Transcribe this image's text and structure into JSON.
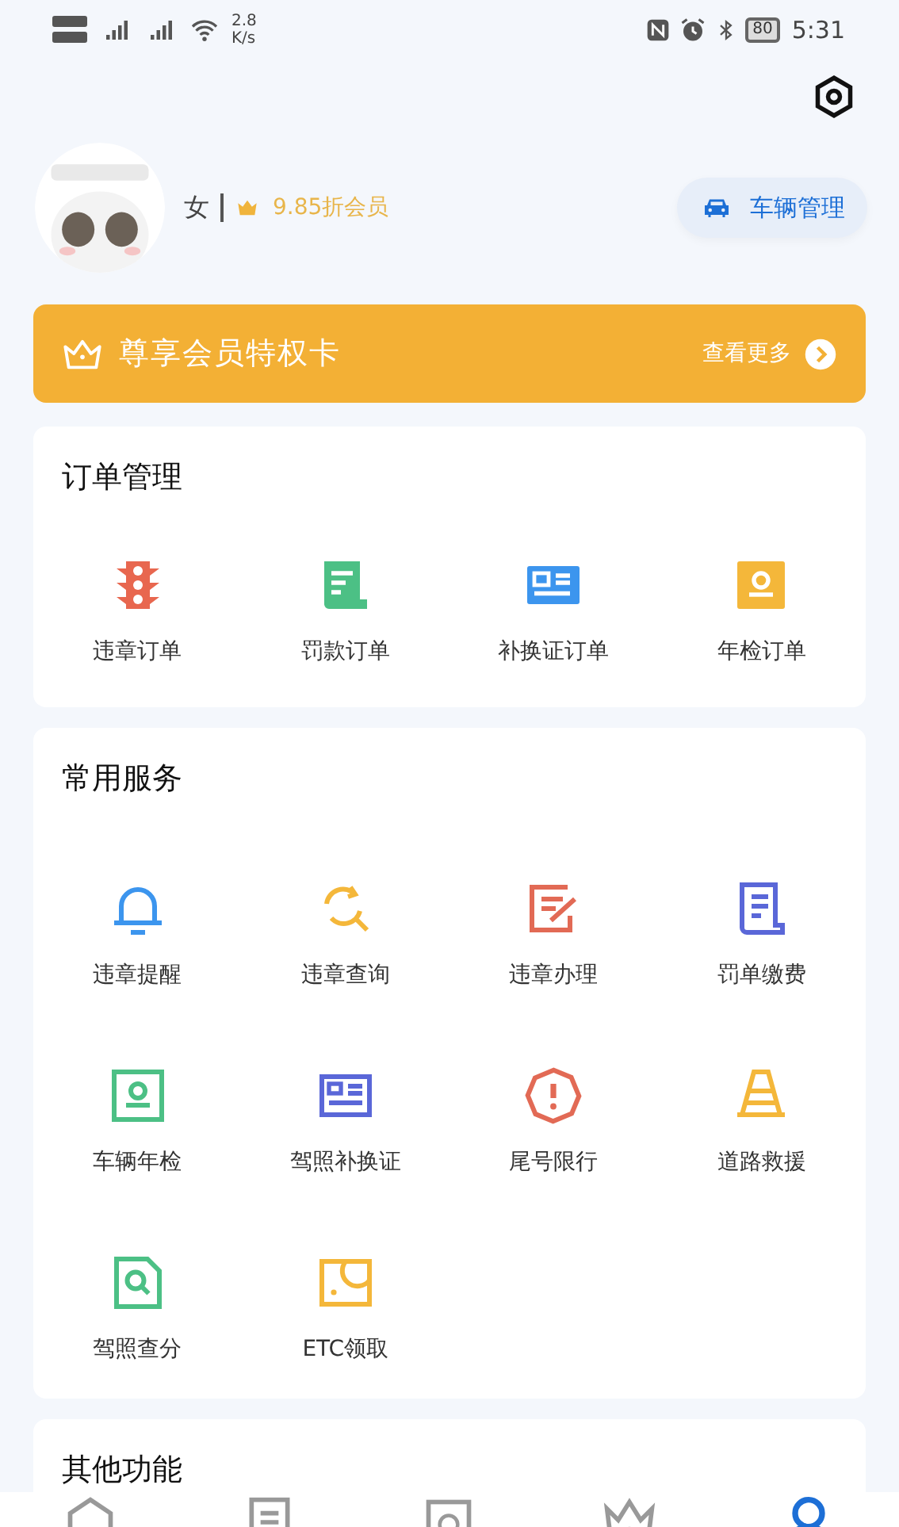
{
  "status_bar": {
    "speed": "2.8",
    "speed_unit": "K/s",
    "battery": "80",
    "time": "5:31"
  },
  "profile": {
    "gender": "女",
    "membership": "9.85折会员",
    "vehicle_button": "车辆管理"
  },
  "vip_banner": {
    "title": "尊享会员特权卡",
    "more": "查看更多"
  },
  "sections": [
    {
      "title": "订单管理",
      "items": [
        {
          "label": "违章订单",
          "kind": "traffic-light",
          "color": "#e8674f"
        },
        {
          "label": "罚款订单",
          "kind": "receipt",
          "color": "#4cc085"
        },
        {
          "label": "补换证订单",
          "kind": "id-card",
          "color": "#3c95ee"
        },
        {
          "label": "年检订单",
          "kind": "badge",
          "color": "#f4b73a"
        }
      ]
    },
    {
      "title": "常用服务",
      "items": [
        {
          "label": "违章提醒",
          "kind": "bell",
          "color": "#3c95ee"
        },
        {
          "label": "违章查询",
          "kind": "refresh-search",
          "color": "#f4b73a"
        },
        {
          "label": "违章办理",
          "kind": "edit",
          "color": "#e26a55"
        },
        {
          "label": "罚单缴费",
          "kind": "document",
          "color": "#5a67d8"
        },
        {
          "label": "车辆年检",
          "kind": "badge-outline",
          "color": "#4cc085"
        },
        {
          "label": "驾照补换证",
          "kind": "card-outline",
          "color": "#5a67d8"
        },
        {
          "label": "尾号限行",
          "kind": "octagon-alert",
          "color": "#e26a55"
        },
        {
          "label": "道路救援",
          "kind": "cone",
          "color": "#f4b73a"
        },
        {
          "label": "驾照查分",
          "kind": "file-search",
          "color": "#4cc085"
        },
        {
          "label": "ETC领取",
          "kind": "etc-card",
          "color": "#f4b73a"
        }
      ]
    },
    {
      "title": "其他功能"
    }
  ],
  "tab_bar": [
    {
      "kind": "home",
      "selected": false
    },
    {
      "kind": "list",
      "selected": false
    },
    {
      "kind": "calendar",
      "selected": false
    },
    {
      "kind": "crown",
      "selected": false
    },
    {
      "kind": "profile",
      "selected": true
    }
  ]
}
